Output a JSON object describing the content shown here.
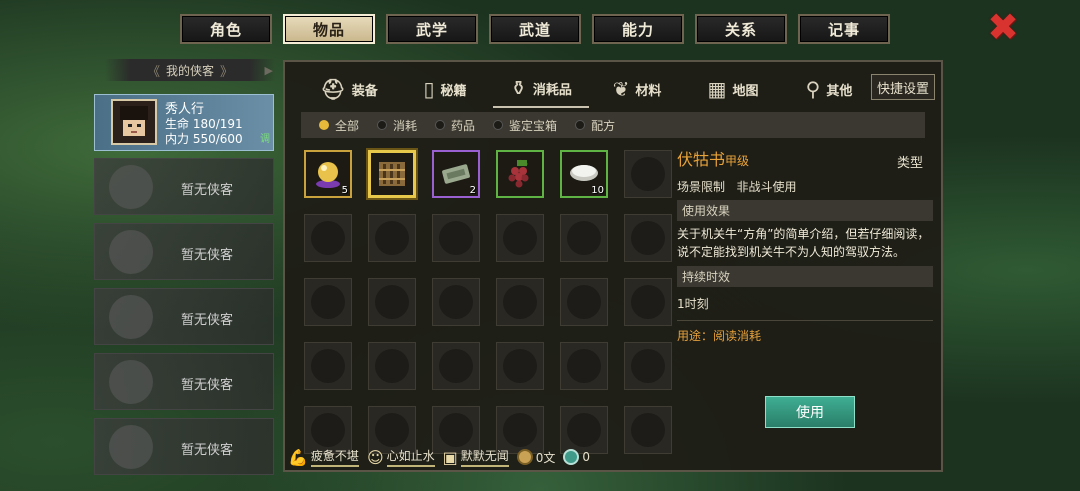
{
  "top_tabs": [
    "角色",
    "物品",
    "武学",
    "武道",
    "能力",
    "关系",
    "记事"
  ],
  "active_tab": 1,
  "close_glyph": "✖",
  "sidebar": {
    "header": "我的侠客",
    "character": {
      "name": "秀人行",
      "hp": "生命 180/191",
      "mp": "内力 550/600",
      "tag": "调"
    },
    "empty_label": "暂无侠客"
  },
  "categories": [
    {
      "label": "装备",
      "icon": "helmet-icon"
    },
    {
      "label": "秘籍",
      "icon": "book-icon"
    },
    {
      "label": "消耗品",
      "icon": "potion-icon"
    },
    {
      "label": "材料",
      "icon": "herb-icon"
    },
    {
      "label": "地图",
      "icon": "map-icon"
    },
    {
      "label": "其他",
      "icon": "mirror-icon"
    }
  ],
  "active_category": 2,
  "quick_settings": "快捷设置",
  "filters": [
    "全部",
    "消耗",
    "药品",
    "鉴定宝箱",
    "配方"
  ],
  "active_filter": 0,
  "items": [
    {
      "name": "orb-icon",
      "qty": "5",
      "rarity": "gold",
      "color": "#e8c24a"
    },
    {
      "name": "scroll-icon",
      "qty": "",
      "rarity": "gold",
      "color": "#8a6a3a"
    },
    {
      "name": "token-icon",
      "qty": "2",
      "rarity": "purple",
      "color": "#9aa88e"
    },
    {
      "name": "grapes-icon",
      "qty": "",
      "rarity": "green",
      "color": "#a8333a"
    },
    {
      "name": "rice-bowl-icon",
      "qty": "10",
      "rarity": "green",
      "color": "#f2f2ee"
    }
  ],
  "detail": {
    "title": "伏牯书",
    "grade": "甲级",
    "type": "类型",
    "scene_label": "场景限制",
    "scene_value": "非战斗使用",
    "effect_header": "使用效果",
    "description": "关于机关牛“方角”的简单介绍，但若仔细阅读，说不定能找到机关牛不为人知的驾驭方法。",
    "duration_header": "持续时效",
    "duration_value": "1时刻",
    "usage": "用途：阅读消耗",
    "use_button": "使用"
  },
  "status": [
    {
      "label": "疲惫不堪",
      "icon": "muscle-icon"
    },
    {
      "label": "心如止水",
      "icon": "face-icon"
    },
    {
      "label": "默默无闻",
      "icon": "fame-icon"
    }
  ],
  "money": "0文",
  "gems": "0"
}
